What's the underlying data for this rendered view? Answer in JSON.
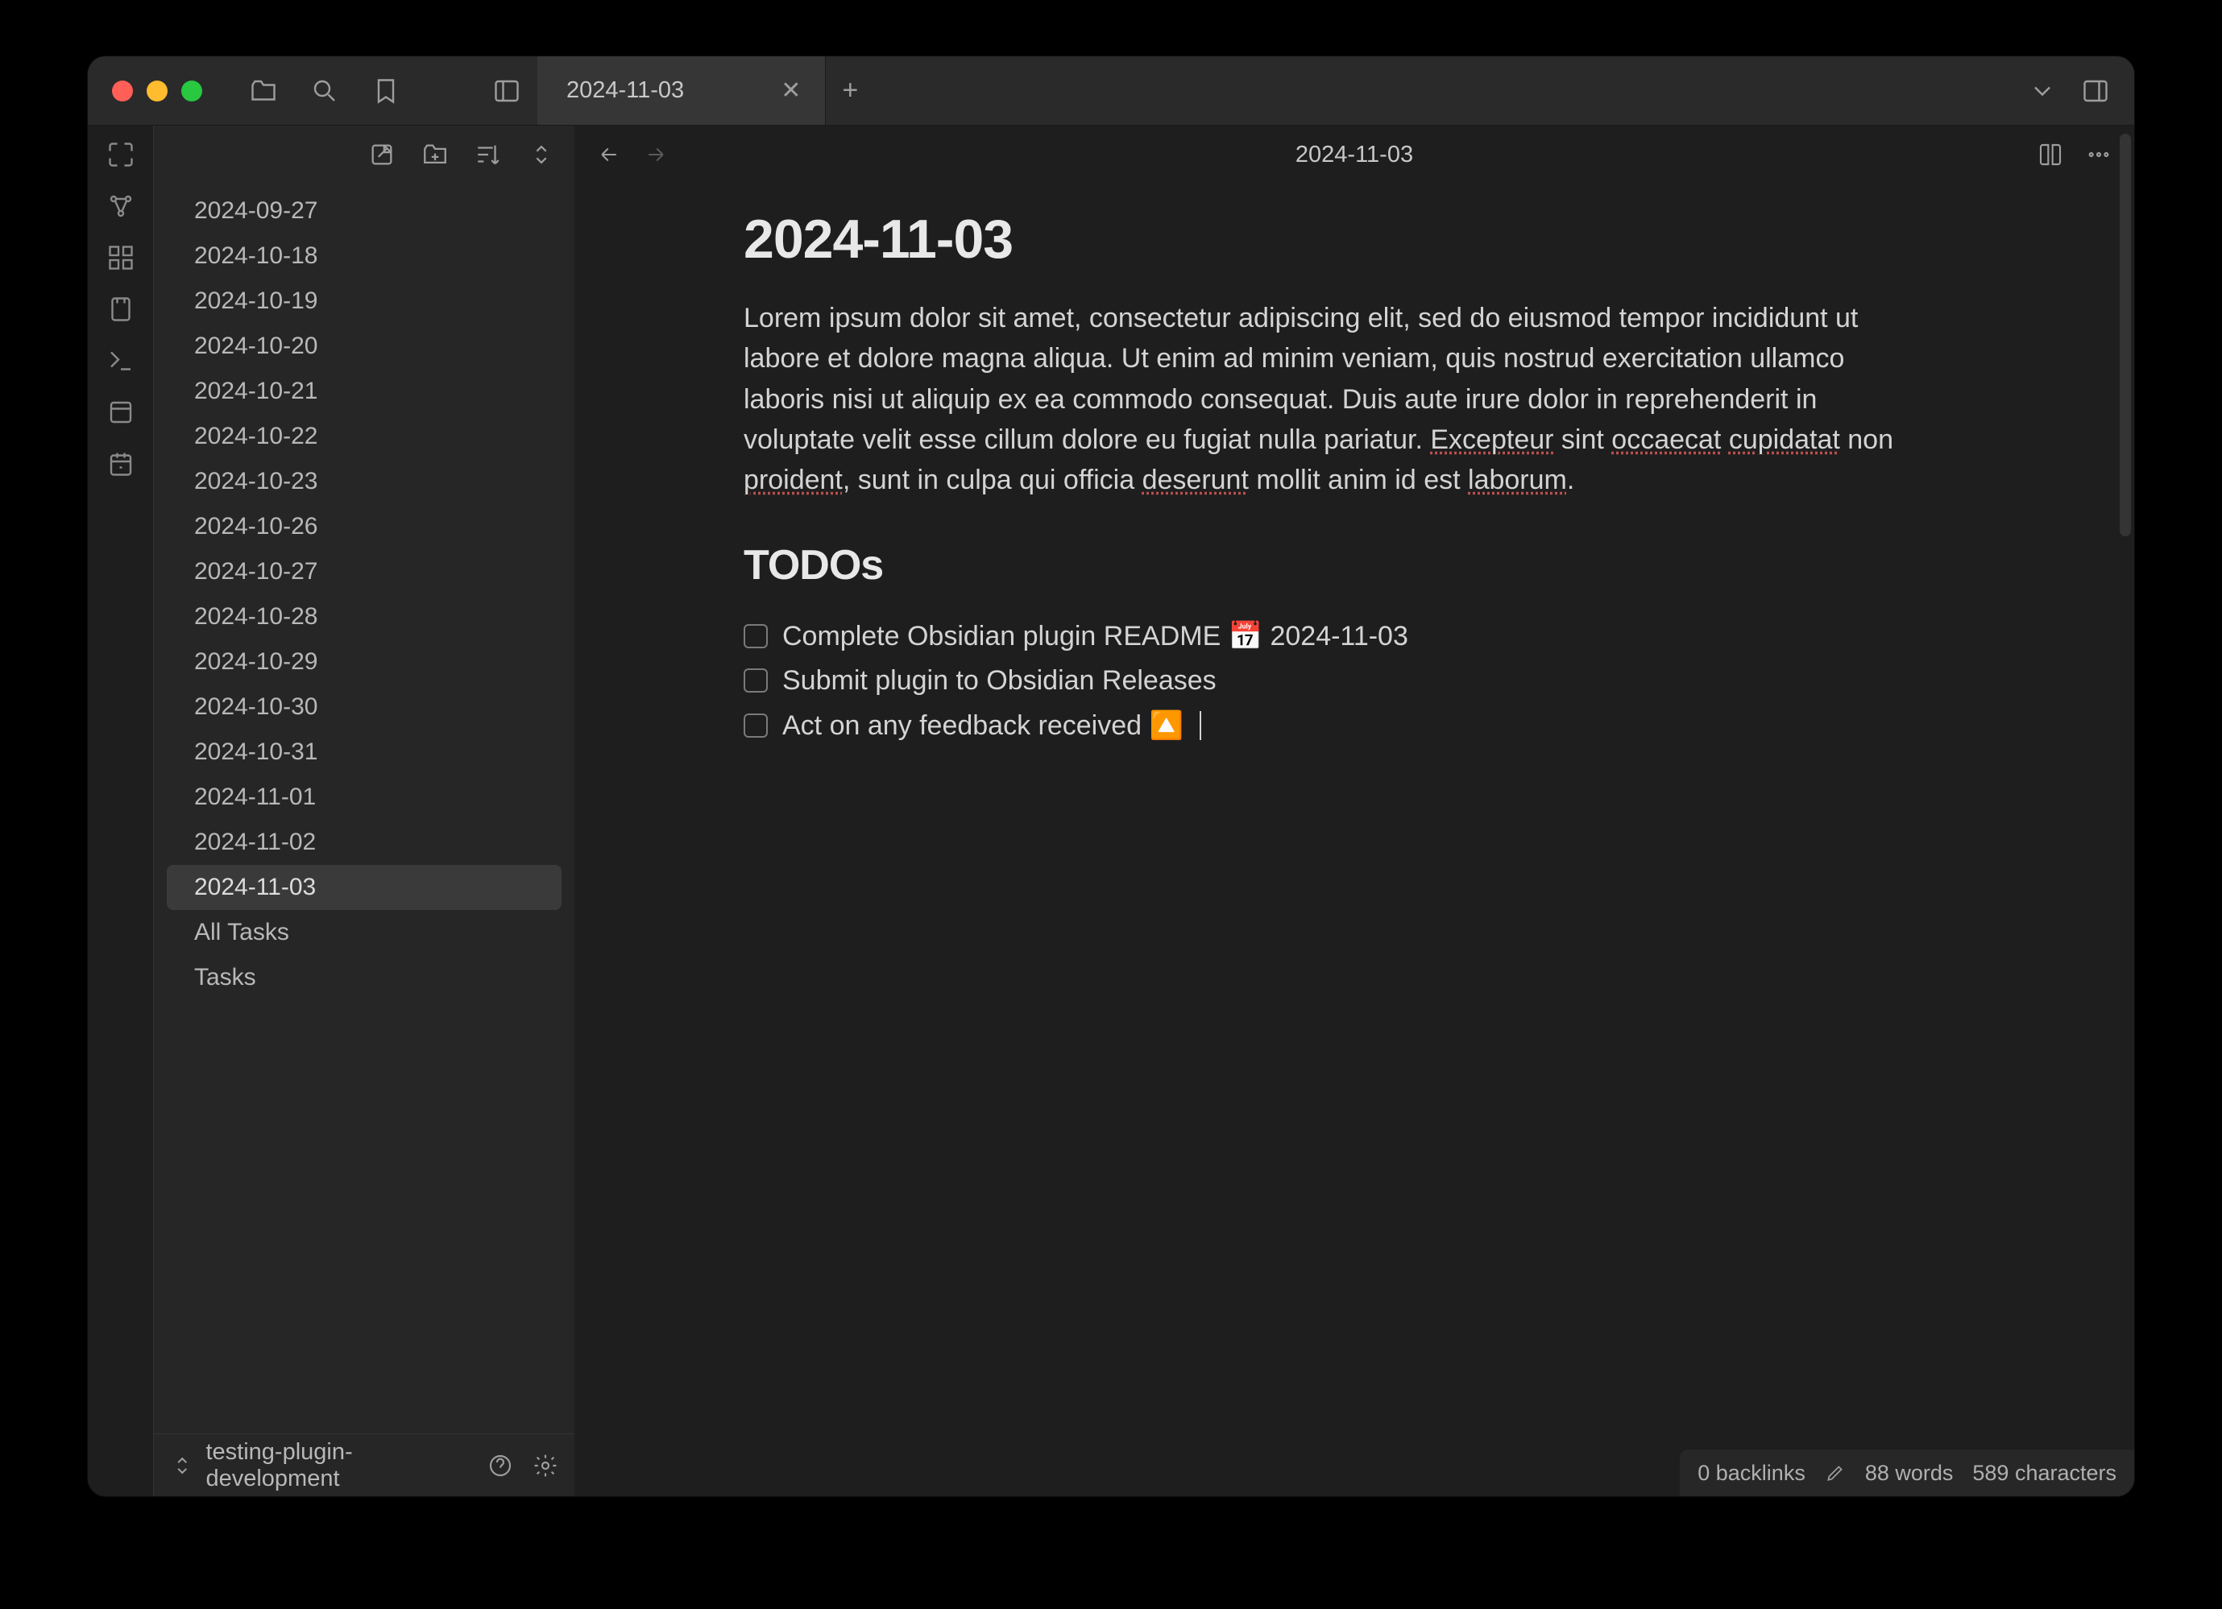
{
  "tab": {
    "title": "2024-11-03"
  },
  "note_title_header": "2024-11-03",
  "sidebar": {
    "files": [
      "2024-09-27",
      "2024-10-18",
      "2024-10-19",
      "2024-10-20",
      "2024-10-21",
      "2024-10-22",
      "2024-10-23",
      "2024-10-26",
      "2024-10-27",
      "2024-10-28",
      "2024-10-29",
      "2024-10-30",
      "2024-10-31",
      "2024-11-01",
      "2024-11-02",
      "2024-11-03",
      "All Tasks",
      "Tasks"
    ],
    "active_index": 15,
    "vault_name": "testing-plugin-development"
  },
  "editor": {
    "h1": "2024-11-03",
    "p_segments": [
      {
        "t": "Lorem ipsum dolor sit amet, consectetur adipiscing elit, sed do eiusmod tempor incididunt ut labore et dolore magna aliqua. Ut enim ad minim veniam, quis nostrud exercitation ullamco laboris nisi ut aliquip ex ea commodo consequat. Duis aute irure dolor in reprehenderit in voluptate velit esse cillum dolore eu fugiat nulla pariatur. "
      },
      {
        "t": "Excepteur",
        "s": true
      },
      {
        "t": " sint "
      },
      {
        "t": "occaecat",
        "s": true
      },
      {
        "t": " "
      },
      {
        "t": "cupidatat",
        "s": true
      },
      {
        "t": " non "
      },
      {
        "t": "proident",
        "s": true
      },
      {
        "t": ", sunt in culpa qui officia "
      },
      {
        "t": "deserunt",
        "s": true
      },
      {
        "t": " mollit anim id est "
      },
      {
        "t": "laborum",
        "s": true
      },
      {
        "t": "."
      }
    ],
    "h2": "TODOs",
    "todos": [
      {
        "text": "Complete Obsidian plugin README ",
        "suffix": "📅 2024-11-03"
      },
      {
        "text": "Submit plugin to Obsidian Releases",
        "suffix": ""
      },
      {
        "text": "Act on any feedback received ",
        "suffix": "🔼",
        "cursor": true
      }
    ]
  },
  "status": {
    "backlinks": "0 backlinks",
    "words": "88 words",
    "chars": "589 characters"
  }
}
